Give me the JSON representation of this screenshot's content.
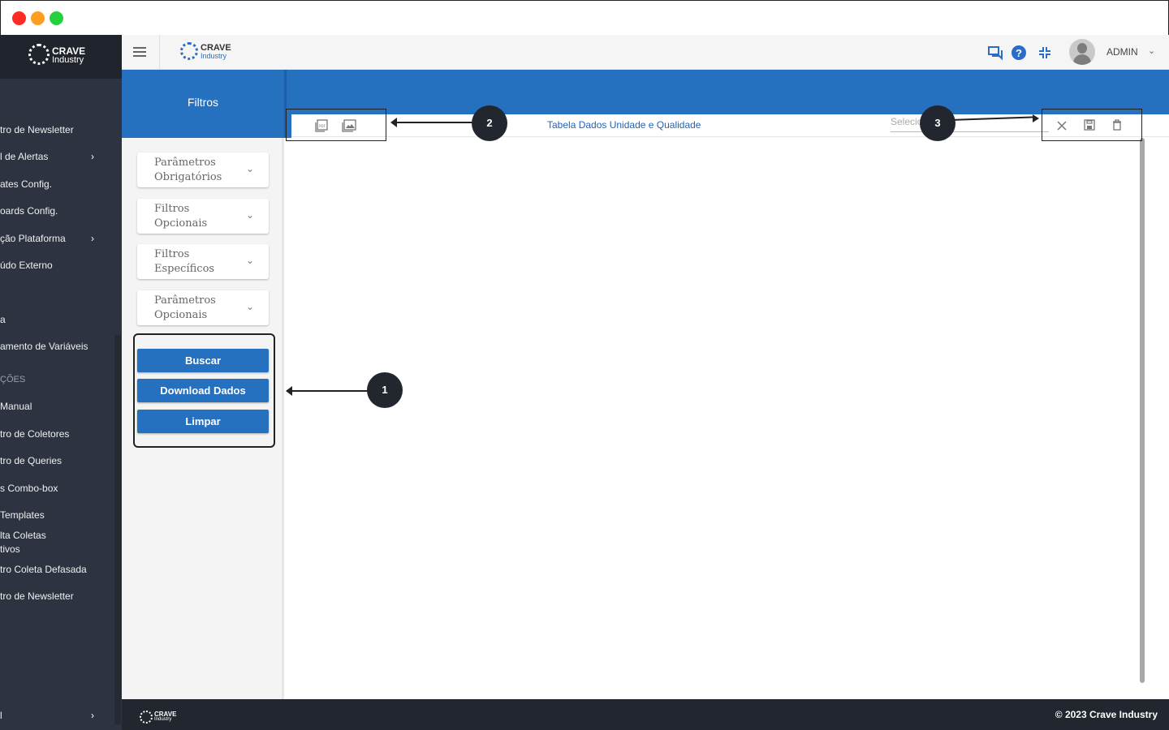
{
  "sidebar": {
    "logo": {
      "line1": "CRAVE",
      "line2": "Industry"
    },
    "items": [
      {
        "label": "tro de Newsletter",
        "has_children": false
      },
      {
        "label": "l de Alertas",
        "has_children": true
      },
      {
        "label": "ates Config.",
        "has_children": false
      },
      {
        "label": "oards Config.",
        "has_children": false
      },
      {
        "label": "ção Plataforma",
        "has_children": true
      },
      {
        "label": "údo Externo",
        "has_children": false
      },
      {
        "label": "a",
        "has_children": false
      },
      {
        "label": "amento de Variáveis",
        "has_children": false
      },
      {
        "label": "ÇÕES",
        "is_section": true
      },
      {
        "label": "Manual",
        "has_children": false
      },
      {
        "label": "tro de Coletores",
        "has_children": false
      },
      {
        "label": "tro de Queries",
        "has_children": false
      },
      {
        "label": "s Combo-box",
        "has_children": false
      },
      {
        "label": "Templates",
        "has_children": false
      },
      {
        "label": "lta Coletas",
        "has_children": false
      },
      {
        "label": "tivos",
        "has_children": false
      },
      {
        "label": "tro Coleta Defasada",
        "has_children": false
      },
      {
        "label": "tro de Newsletter",
        "has_children": false
      }
    ],
    "bottom_item": {
      "label": "l",
      "has_children": true
    }
  },
  "topbar": {
    "logo": {
      "line1": "CRAVE",
      "line2": "Industry"
    },
    "icons": [
      "chat-icon",
      "help-icon",
      "collapse-icon"
    ],
    "user_label": "ADMIN"
  },
  "filters": {
    "title": "Filtros",
    "accordions": [
      {
        "label": "Parâmetros Obrigatórios"
      },
      {
        "label": "Filtros Opcionais"
      },
      {
        "label": "Filtros Específicos"
      },
      {
        "label": "Parâmetros Opcionais"
      }
    ],
    "buttons": {
      "search": "Buscar",
      "download": "Download Dados",
      "clear": "Limpar"
    }
  },
  "main": {
    "title": "Tabela Dados Unidade e Qualidade",
    "select_placeholder": "Selecio",
    "left_icons": [
      "pdf-icon",
      "image-icon"
    ],
    "right_icons": [
      "close-icon",
      "save-icon",
      "delete-icon"
    ]
  },
  "annotations": {
    "marker1": "1",
    "marker2": "2",
    "marker3": "3"
  },
  "footer": {
    "logo": {
      "line1": "CRAVE",
      "line2": "Industry"
    },
    "copyright": "© 2023 Crave Industry"
  },
  "colors": {
    "primary_blue": "#2570bf",
    "sidebar_bg": "#2d3340",
    "footer_bg": "#22262e"
  }
}
